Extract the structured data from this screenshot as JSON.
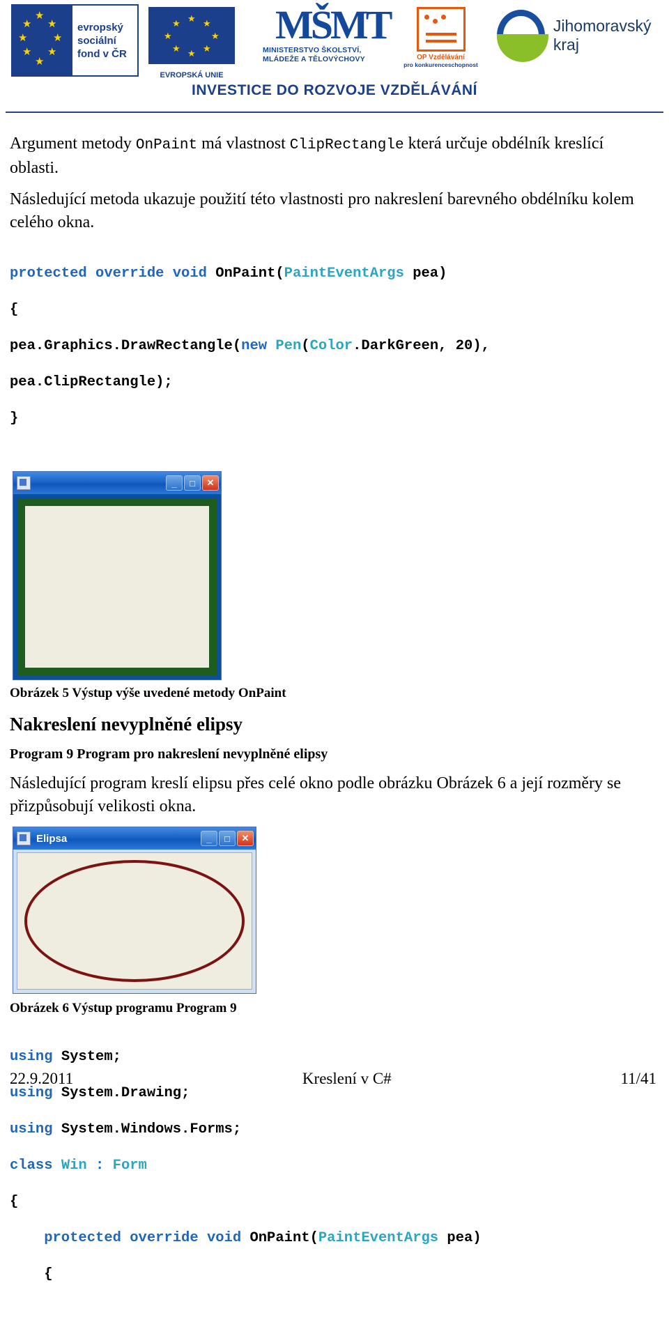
{
  "header": {
    "esf": {
      "line1": "evropský",
      "line2": "sociální",
      "line3": "fond v ČR"
    },
    "eu_caption": "EVROPSKÁ UNIE",
    "msmt": {
      "mark": "MŠMT",
      "line1": "MINISTERSTVO ŠKOLSTVÍ,",
      "line2": "MLÁDEŽE A TĚLOVÝCHOVY"
    },
    "opvk": {
      "line1": "OP Vzdělávání",
      "line2": "pro konkurenceschopnost"
    },
    "jmk": "Jihomoravský kraj",
    "invest": "INVESTICE DO ROZVOJE VZDĚLÁVÁNÍ"
  },
  "body": {
    "para1_a": "Argument metody ",
    "para1_mono1": "OnPaint",
    "para1_b": " má vlastnost ",
    "para1_mono2": "ClipRectangle",
    "para1_c": " která určuje obdélník kreslící oblasti.",
    "para2": "Následující metoda ukazuje použití této vlastnosti pro nakreslení barevného obdélníku kolem celého okna.",
    "code1_l1_kw": "protected override void",
    "code1_l1_rest": " OnPaint(",
    "code1_l1_cls": "PaintEventArgs",
    "code1_l1_tail": " pea)",
    "code1_l2": "{",
    "code1_l3_a": "pea.Graphics.DrawRectangle(",
    "code1_l3_kw": "new",
    "code1_l3_b": " ",
    "code1_l3_cls": "Pen",
    "code1_l3_c": "(",
    "code1_l3_cls2": "Color",
    "code1_l3_d": ".DarkGreen, 20),",
    "code1_l4": "pea.ClipRectangle);",
    "code1_l5": "}",
    "fig5_caption": "Obrázek 5 Výstup výše uvedené metody OnPaint",
    "section_title": "Nakreslení nevyplněné elipsy",
    "program_title": "Program 9 Program pro nakreslení nevyplněné elipsy",
    "para3": "Následující program kreslí elipsu přes celé okno podle obrázku Obrázek 6 a její rozměry se přizpůsobují velikosti okna.",
    "fig6_caption": "Obrázek 6 Výstup programu Program 9",
    "code2_l1_kw": "using",
    "code2_l1_rest": " System;",
    "code2_l2_kw": "using",
    "code2_l2_rest": " System.Drawing;",
    "code2_l3_kw": "using",
    "code2_l3_rest": " System.Windows.Forms;",
    "code2_l4_kw": "class",
    "code2_l4_cls": " Win",
    "code2_l4_colon": " : ",
    "code2_l4_cls2": "Form",
    "code2_l5": "{",
    "code2_l6_kw": "    protected override void",
    "code2_l6_rest": " OnPaint(",
    "code2_l6_cls": "PaintEventArgs",
    "code2_l6_tail": " pea)",
    "code2_l7": "    {"
  },
  "windows": {
    "win1": {
      "title": "",
      "minimize": "_",
      "maximize": "□",
      "close": "✕"
    },
    "win2": {
      "title": "Elipsa",
      "minimize": "_",
      "maximize": "□",
      "close": "✕"
    }
  },
  "footer": {
    "date": "22.9.2011",
    "title": "Kreslení v C#",
    "page": "11/41"
  },
  "colors": {
    "eu_blue": "#1b3f8b",
    "star_yellow": "#f5d20c",
    "orange": "#e8580c",
    "jmk_blue": "#1a4fa0",
    "jmk_green": "#8bbf2a",
    "darkgreen_pen": "#1f5c1f",
    "ellipse_red": "#7b1313",
    "code_keyword": "#2166b8",
    "code_class": "#2aa6c0"
  }
}
